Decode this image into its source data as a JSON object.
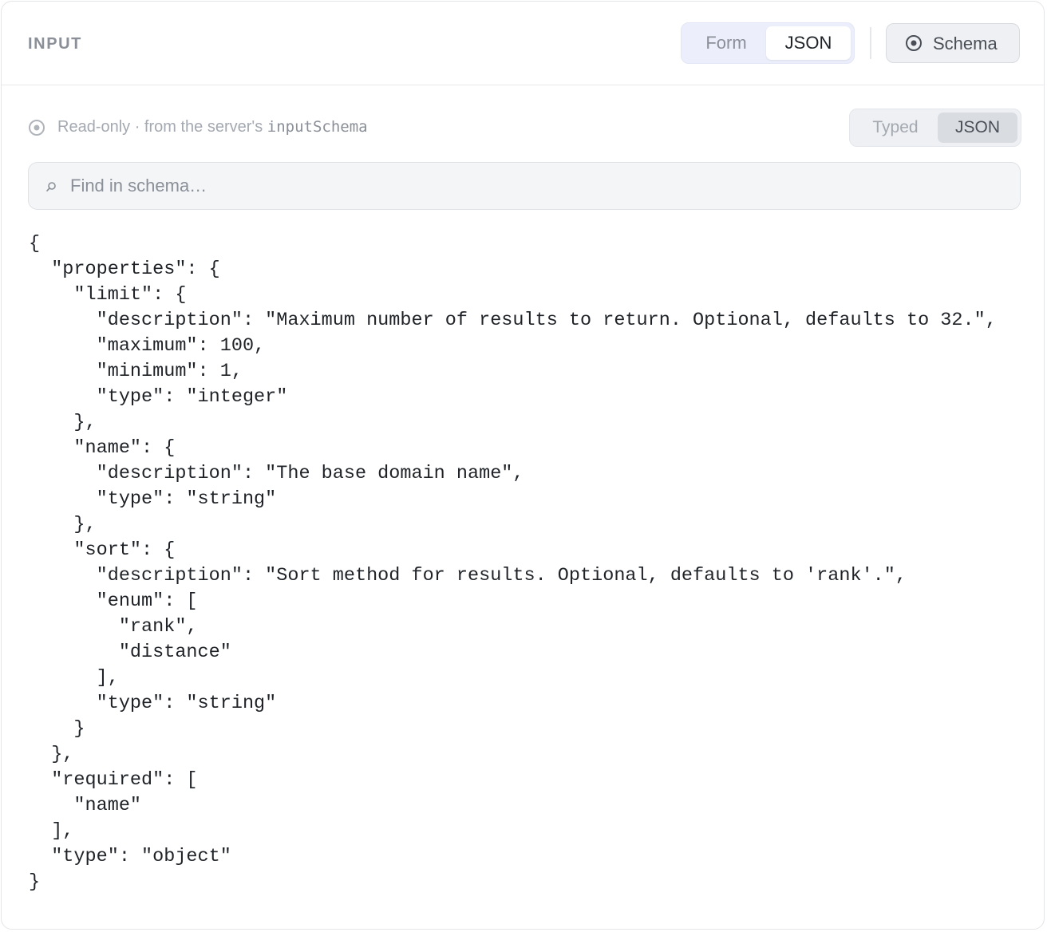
{
  "header": {
    "title": "INPUT",
    "mode_tabs": [
      {
        "label": "Form",
        "active": false
      },
      {
        "label": "JSON",
        "active": true
      }
    ],
    "schema_button": {
      "label": "Schema",
      "icon": "target-icon"
    }
  },
  "readonly": {
    "icon": "target-icon",
    "text": "Read-only · from the server's ",
    "code": "inputSchema"
  },
  "view_tabs": [
    {
      "label": "Typed",
      "active": false
    },
    {
      "label": "JSON",
      "active": true
    }
  ],
  "search": {
    "icon": "search-icon",
    "placeholder": "Find in schema…"
  },
  "schema_json": "{\n  \"properties\": {\n    \"limit\": {\n      \"description\": \"Maximum number of results to return. Optional, defaults to 32.\",\n      \"maximum\": 100,\n      \"minimum\": 1,\n      \"type\": \"integer\"\n    },\n    \"name\": {\n      \"description\": \"The base domain name\",\n      \"type\": \"string\"\n    },\n    \"sort\": {\n      \"description\": \"Sort method for results. Optional, defaults to 'rank'.\",\n      \"enum\": [\n        \"rank\",\n        \"distance\"\n      ],\n      \"type\": \"string\"\n    }\n  },\n  \"required\": [\n    \"name\"\n  ],\n  \"type\": \"object\"\n}",
  "colors": {
    "muted_text": "#8a8f98",
    "active_tab_bg": "#ffffff",
    "segment_bg": "#eceffb"
  }
}
